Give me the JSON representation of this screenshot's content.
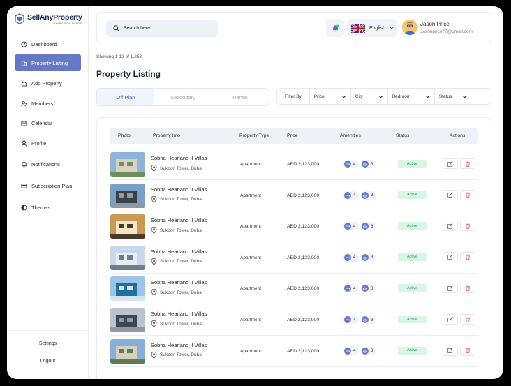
{
  "brand": {
    "name": "SellAnyProperty",
    "tagline": "LUXURY REAL ESTATE"
  },
  "sidebar": {
    "items": [
      {
        "label": "Dashboard",
        "icon": "dashboard-icon"
      },
      {
        "label": "Property Listing",
        "icon": "building-icon",
        "active": true
      },
      {
        "label": "Add Property",
        "icon": "add-property-icon"
      },
      {
        "label": "Members",
        "icon": "members-icon"
      },
      {
        "label": "Calendar",
        "icon": "calendar-icon"
      },
      {
        "label": "Profile",
        "icon": "profile-icon"
      },
      {
        "label": "Notifications",
        "icon": "bell-icon"
      },
      {
        "label": "Subscription Plan",
        "icon": "subscription-icon"
      },
      {
        "label": "Themes",
        "icon": "themes-icon"
      }
    ],
    "settings": "Settings",
    "logout": "Logout"
  },
  "header": {
    "search_placeholder": "Search here",
    "language": "English",
    "user_name": "Jason Price",
    "user_email": "Jasonprice77@gmail.com"
  },
  "main": {
    "showing": "Showing 1-12 of 1,253",
    "title": "Property Listing",
    "tabs": [
      "Off Plan",
      "Secondary",
      "Rental"
    ],
    "filter_label": "Filter By",
    "filters": [
      "Price",
      "City",
      "Bedroom",
      "Status"
    ]
  },
  "table": {
    "headers": [
      "Photo",
      "Property Info",
      "Property Type",
      "Price",
      "Amenities",
      "Status",
      "Actions"
    ],
    "rows": [
      {
        "name": "Sobha Hearland II Villas",
        "location": "Sukoon Tower, Dubai",
        "type": "Apartment",
        "price": "AED 2,123,000",
        "beds": "4",
        "baths": "3",
        "status": "Active"
      },
      {
        "name": "Sobha Hearland II Villas",
        "location": "Sukoon Tower, Dubai",
        "type": "Apartment",
        "price": "AED 2,123,000",
        "beds": "4",
        "baths": "3",
        "status": "Active"
      },
      {
        "name": "Sobha Hearland II Villas",
        "location": "Sukoon Tower, Dubai",
        "type": "Apartment",
        "price": "AED 2,123,000",
        "beds": "4",
        "baths": "3",
        "status": "Active"
      },
      {
        "name": "Sobha Hearland II Villas",
        "location": "Sukoon Tower, Dubai",
        "type": "Apartment",
        "price": "AED 2,123,000",
        "beds": "4",
        "baths": "3",
        "status": "Active"
      },
      {
        "name": "Sobha Hearland II Villas",
        "location": "Sukoon Tower, Dubai",
        "type": "Apartment",
        "price": "AED 2,123,000",
        "beds": "4",
        "baths": "3",
        "status": "Active"
      },
      {
        "name": "Sobha Hearland II Villas",
        "location": "Sukoon Tower, Dubai",
        "type": "Apartment",
        "price": "AED 2,123,000",
        "beds": "4",
        "baths": "3",
        "status": "Active"
      },
      {
        "name": "Sobha Hearland II Villas",
        "location": "Sukoon Tower, Dubai",
        "type": "Apartment",
        "price": "AED 2,123,000",
        "beds": "4",
        "baths": "3",
        "status": "Active"
      }
    ]
  },
  "colors": {
    "accent": "#6579c7",
    "status_bg": "#d9f6e4",
    "status_text": "#22a05b",
    "delete": "#e24a4a"
  }
}
